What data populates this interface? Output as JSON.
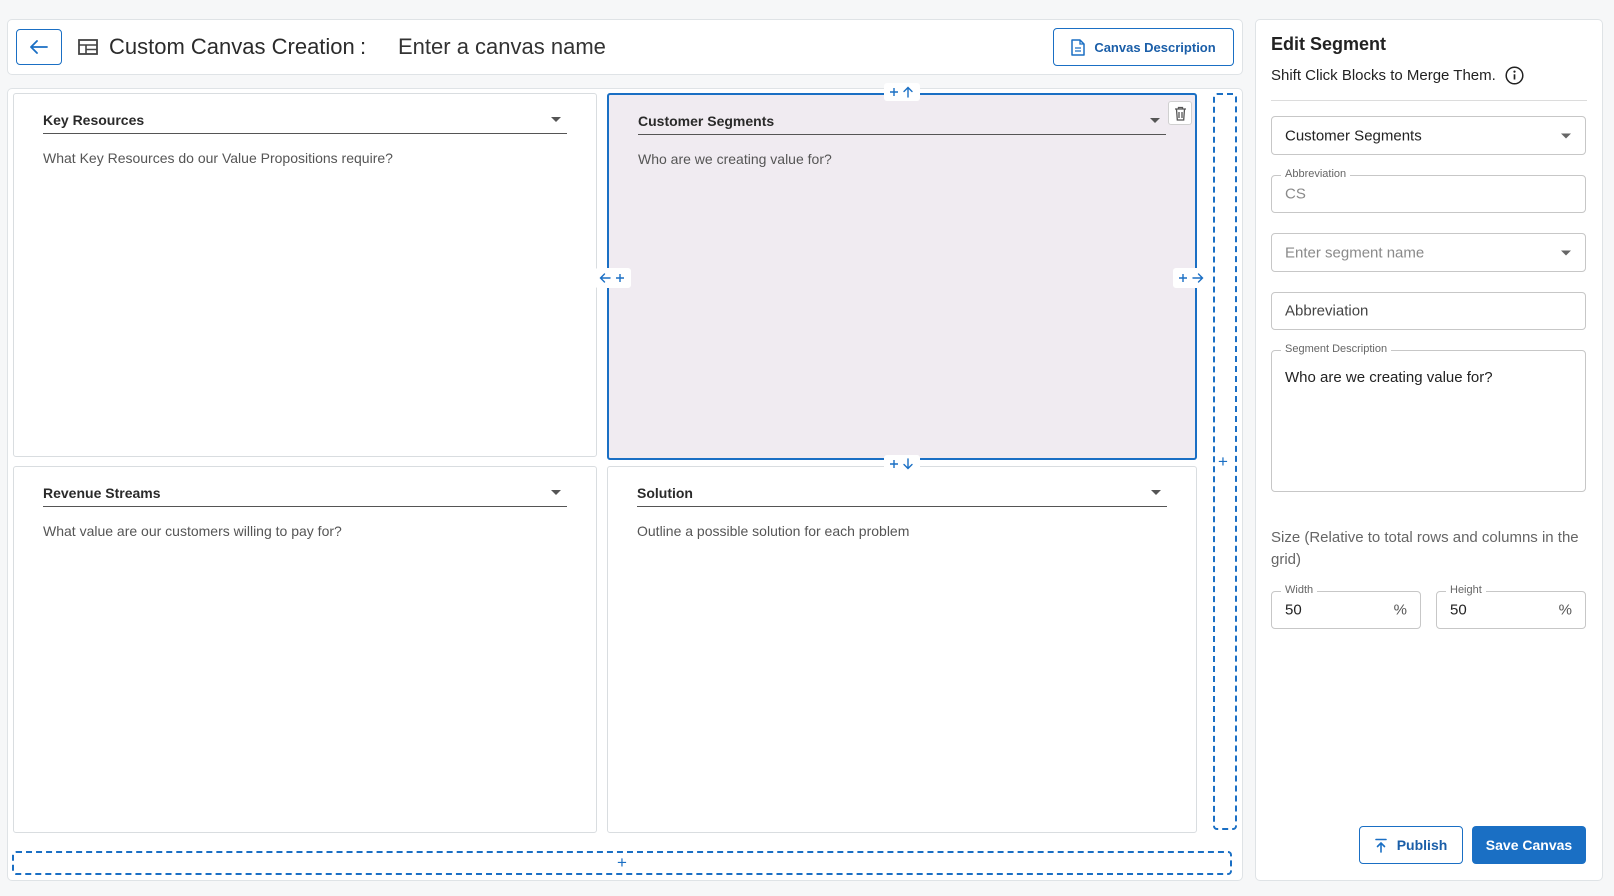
{
  "header": {
    "title": "Custom Canvas Creation",
    "colon": ":",
    "canvas_name_placeholder": "Enter a canvas name",
    "canvas_description_label": "Canvas Description"
  },
  "canvas": {
    "segments": [
      {
        "title": "Key Resources",
        "description": "What Key Resources do our Value Propositions require?"
      },
      {
        "title": "Customer Segments",
        "description": "Who are we creating value for?"
      },
      {
        "title": "Revenue Streams",
        "description": "What value are our customers willing to pay for?"
      },
      {
        "title": "Solution",
        "description": "Outline a possible solution for each problem"
      }
    ],
    "selected_segment": "Customer Segments",
    "add_row_plus": "+",
    "add_col_plus": "+"
  },
  "panel": {
    "title": "Edit Segment",
    "hint": "Shift Click Blocks to Merge Them.",
    "segment_select_value": "Customer Segments",
    "abbreviation_label": "Abbreviation",
    "abbreviation_value": "CS",
    "segment_name_placeholder": "Enter segment name",
    "abbreviation_placeholder": "Abbreviation",
    "description_label": "Segment Description",
    "description_value": "Who are we creating value for?",
    "size_note": "Size (Relative to total rows and columns in the grid)",
    "width_label": "Width",
    "width_value": "50",
    "height_label": "Height",
    "height_value": "50",
    "percent": "%",
    "publish_label": "Publish",
    "save_label": "Save Canvas"
  },
  "colors": {
    "accent": "#1a6fc4",
    "selected_bg": "#f0ebf1"
  }
}
